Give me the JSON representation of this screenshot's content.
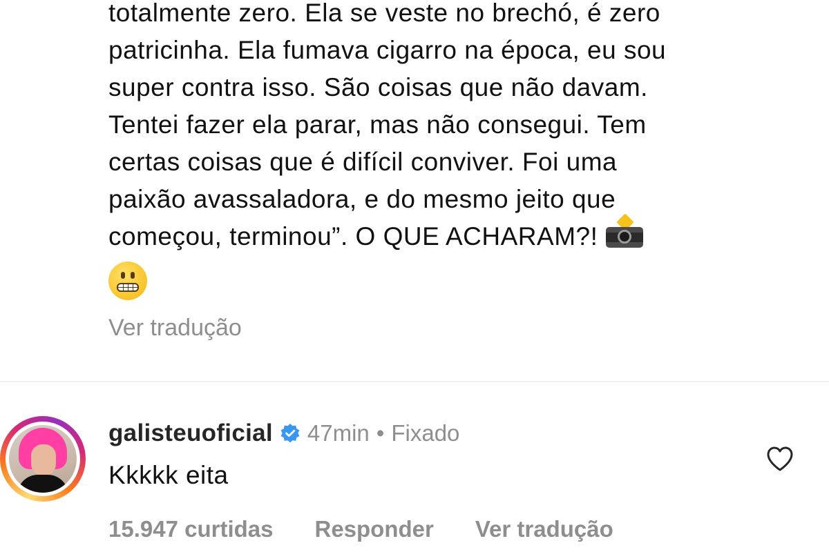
{
  "post": {
    "caption_lines": [
      "totalmente zero. Ela se veste no brechó, é zero",
      "patricinha. Ela fumava cigarro na época, eu sou",
      "super contra isso. São coisas que não davam.",
      "Tentei fazer ela parar, mas não consegui. Tem",
      "certas coisas que é difícil conviver. Foi uma",
      "paixão avassaladora, e do mesmo jeito que",
      "começou, terminou”. O QUE ACHARAM?!"
    ],
    "emojis": [
      "camera-with-flash-icon",
      "grimacing-face-icon"
    ],
    "see_translation": "Ver tradução"
  },
  "comment": {
    "username": "galisteuoficial",
    "verified": true,
    "time": "47min",
    "separator": "•",
    "pinned_label": "Fixado",
    "text": "Kkkkk eita",
    "likes": "15.947 curtidas",
    "reply_label": "Responder",
    "see_translation": "Ver tradução",
    "like_icon": "heart-outline-icon"
  },
  "colors": {
    "text_primary": "#111111",
    "text_secondary": "#8e8e8e",
    "verified_blue": "#3897f0",
    "divider": "#efefef"
  }
}
